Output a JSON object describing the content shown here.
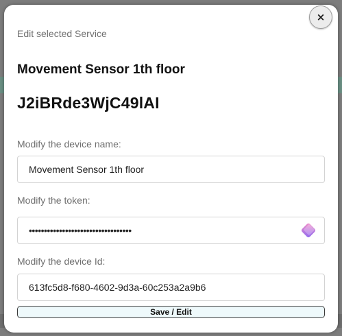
{
  "modal": {
    "close_label": "×",
    "title": "Edit selected Service",
    "device_name_heading": "Movement Sensor 1th floor",
    "device_id_heading": "J2iBRde3WjC49lAI"
  },
  "fields": {
    "name": {
      "label": "Modify the device name:",
      "value": "Movement Sensor 1th floor"
    },
    "token": {
      "label": "Modify the token:",
      "value": "••••••••••••••••••••••••••••••••••",
      "icon": "password-manager-icon"
    },
    "device_id": {
      "label": "Modify the device Id:",
      "value": "613fc5d8-f680-4602-9d3a-60c253a2a9b6"
    }
  },
  "actions": {
    "save_label": "Save / Edit"
  },
  "colors": {
    "save_button_bg": "#eef9fb",
    "label_gray": "#6f6f6f",
    "token_icon_gradient": [
      "#f08bc8",
      "#8f6cf0"
    ]
  }
}
